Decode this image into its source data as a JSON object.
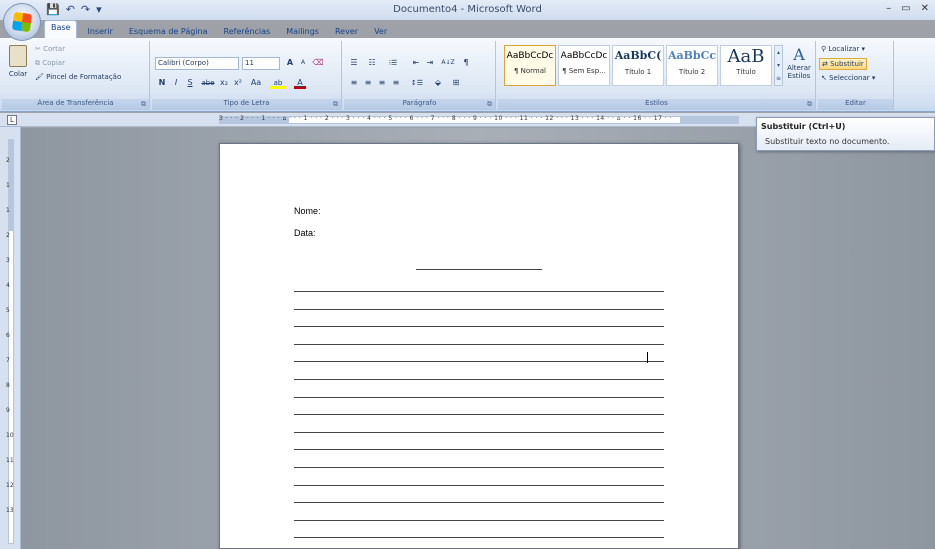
{
  "window": {
    "title": "Documento4 - Microsoft Word",
    "controls": [
      "–",
      "▭",
      "✕"
    ]
  },
  "quick_access": [
    "💾",
    "↶",
    "↷",
    "▾"
  ],
  "tabs": [
    {
      "label": "Base",
      "active": true
    },
    {
      "label": "Inserir"
    },
    {
      "label": "Esquema de Página"
    },
    {
      "label": "Referências"
    },
    {
      "label": "Mailings"
    },
    {
      "label": "Rever"
    },
    {
      "label": "Ver"
    }
  ],
  "ribbon": {
    "clipboard": {
      "label": "Área de Transferência",
      "paste": "Colar",
      "cut": "Cortar",
      "copy": "Copiar",
      "format_painter": "Pincel de Formatação"
    },
    "font": {
      "label": "Tipo de Letra",
      "family": "Calibri (Corpo)",
      "size": "11",
      "bold": "N",
      "italic": "I",
      "underline": "S",
      "strike": "abe",
      "subscript": "x₂",
      "superscript": "x²",
      "change_case": "Aa",
      "grow": "A",
      "shrink": "A",
      "highlight": "ab",
      "font_color": "A"
    },
    "paragraph": {
      "label": "Parágrafo",
      "bullets": "☰",
      "numbering": "☷",
      "multilevel": "⁝☰",
      "outdent": "⇤",
      "indent": "⇥",
      "sort": "A↓Z",
      "pilcrow": "¶",
      "align": [
        "≡",
        "≡",
        "≡",
        "≡"
      ],
      "spacing": "↕☰"
    },
    "styles": {
      "label": "Estilos",
      "items": [
        {
          "preview": "AaBbCcDc",
          "name": "¶ Normal",
          "selected": true
        },
        {
          "preview": "AaBbCcDc",
          "name": "¶ Sem Esp..."
        },
        {
          "preview": "AaBbC(",
          "name": "Título 1"
        },
        {
          "preview": "AaBbCc",
          "name": "Título 2"
        },
        {
          "preview": "AaB",
          "name": "Título"
        }
      ],
      "change_styles": "Alterar Estilos"
    },
    "editing": {
      "label": "Editar",
      "find": "Localizar",
      "replace": "Substituir",
      "select": "Seleccionar"
    }
  },
  "ruler": {
    "corner": "L",
    "labels": "3 · · · 2 · · · 1 · · · ⌂ · · · 1 · · · 2 · · · 3 · · · 4 · · · 5 · · · 6 · · · 7 · · · 8 · · · 9 · · · 10 · · · 11 · · · 12 · · · 13 · · · 14 · · ⌂ · · 16 · · 17 · ·",
    "vertical_labels": [
      "2",
      "1",
      "1",
      "2",
      "3",
      "4",
      "5",
      "6",
      "7",
      "8",
      "9",
      "10",
      "11",
      "12",
      "13"
    ]
  },
  "document": {
    "name_label": "Nome:",
    "date_label": "Data:"
  },
  "tooltip": {
    "title": "Substituir (Ctrl+U)",
    "body": "Substituir texto no documento."
  }
}
